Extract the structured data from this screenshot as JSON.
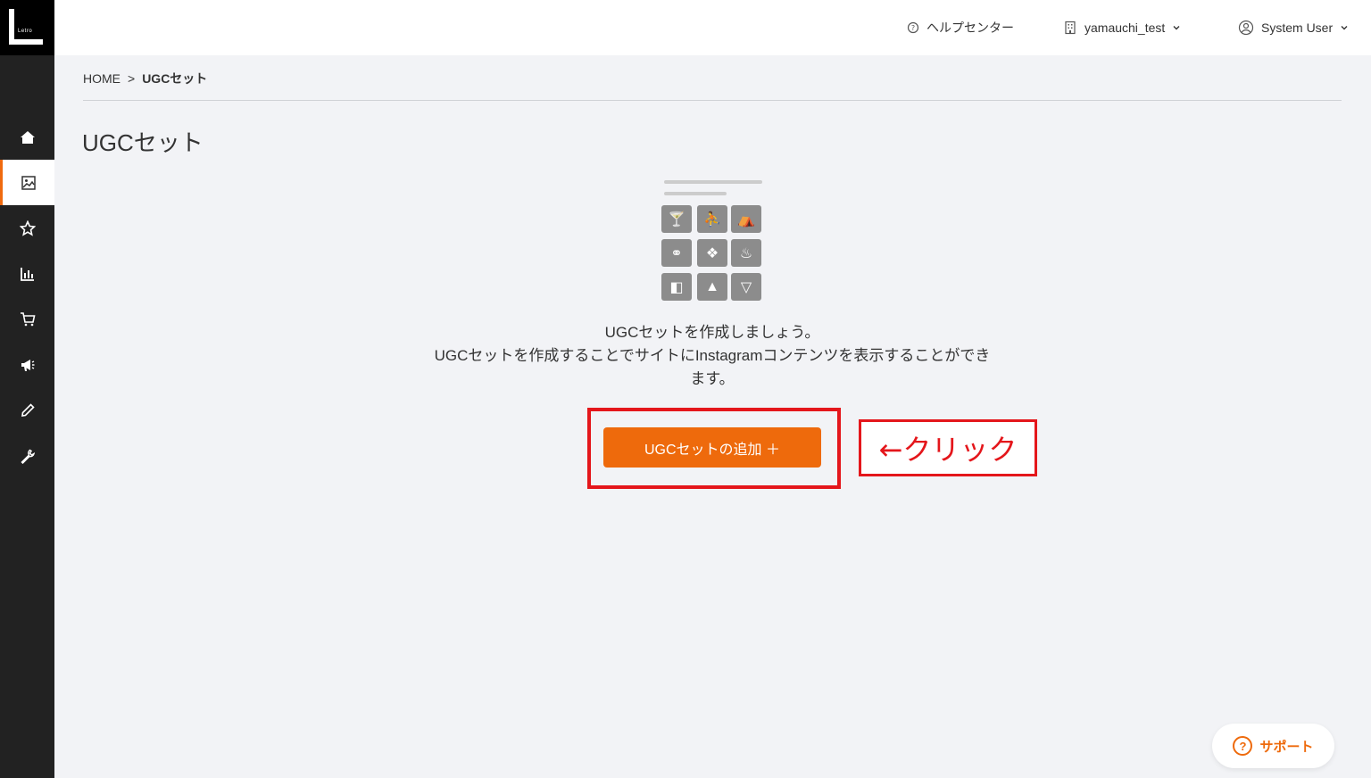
{
  "logo": {
    "text": "Letro"
  },
  "header": {
    "help_label": "ヘルプセンター",
    "account_label": "yamauchi_test",
    "user_label": "System User"
  },
  "breadcrumb": {
    "home": "HOME",
    "separator": ">",
    "current": "UGCセット"
  },
  "page": {
    "title": "UGCセット",
    "message_line1": "UGCセットを作成しましょう。",
    "message_line2": "UGCセットを作成することでサイトにInstagramコンテンツを表示することができ",
    "message_line3": "ます。",
    "add_button": "UGCセットの追加 ＋"
  },
  "annotation": {
    "text": "←クリック"
  },
  "support": {
    "label": "サポート",
    "icon_glyph": "?"
  },
  "sidebar": {
    "items": [
      {
        "name": "home",
        "icon": "home-icon"
      },
      {
        "name": "ugc",
        "icon": "image-icon",
        "active": true
      },
      {
        "name": "favorites",
        "icon": "star-icon"
      },
      {
        "name": "analytics",
        "icon": "bar-chart-icon"
      },
      {
        "name": "shop",
        "icon": "cart-icon"
      },
      {
        "name": "campaign",
        "icon": "megaphone-icon"
      },
      {
        "name": "edit",
        "icon": "pencil-icon"
      },
      {
        "name": "settings",
        "icon": "wrench-icon"
      }
    ]
  },
  "colors": {
    "accent": "#ee6a0c",
    "highlight": "#e4161b",
    "sidebar": "#222222"
  }
}
